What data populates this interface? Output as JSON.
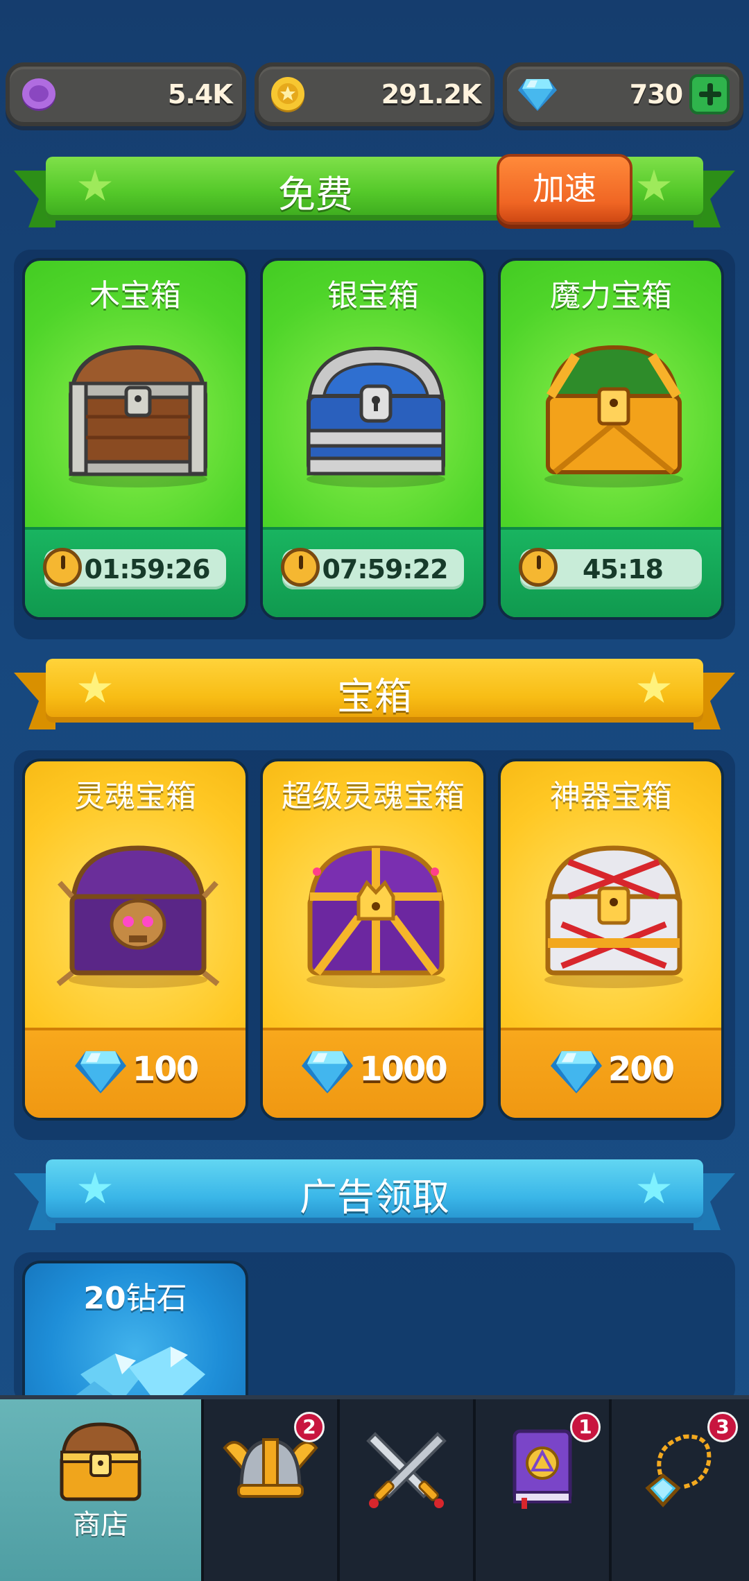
{
  "currencies": [
    {
      "name": "soul-token",
      "value": "5.4K",
      "color": "#a05ad6"
    },
    {
      "name": "gold-coin",
      "value": "291.2K",
      "color": "#f5c431"
    },
    {
      "name": "diamond",
      "value": "730",
      "color": "#3ab7ec"
    }
  ],
  "sections": {
    "free": {
      "title": "免费",
      "speed_label": "加速"
    },
    "chests": {
      "title": "宝箱"
    },
    "ads": {
      "title": "广告领取"
    }
  },
  "free_chests": [
    {
      "name": "木宝箱",
      "timer": "01:59:26"
    },
    {
      "name": "银宝箱",
      "timer": "07:59:22"
    },
    {
      "name": "魔力宝箱",
      "timer": "45:18"
    }
  ],
  "paid_chests": [
    {
      "name": "灵魂宝箱",
      "price": "100"
    },
    {
      "name": "超级灵魂宝箱",
      "price": "1000"
    },
    {
      "name": "神器宝箱",
      "price": "200"
    }
  ],
  "ad_rewards": [
    {
      "amount": "20",
      "label": "钻石"
    }
  ],
  "bottom_nav": [
    {
      "name": "shop",
      "label": "商店",
      "active": true,
      "badge": ""
    },
    {
      "name": "heroes",
      "label": "",
      "active": false,
      "badge": "2"
    },
    {
      "name": "battle",
      "label": "",
      "active": false,
      "badge": ""
    },
    {
      "name": "spellbook",
      "label": "",
      "active": false,
      "badge": "1"
    },
    {
      "name": "artifacts",
      "label": "",
      "active": false,
      "badge": "3"
    }
  ]
}
